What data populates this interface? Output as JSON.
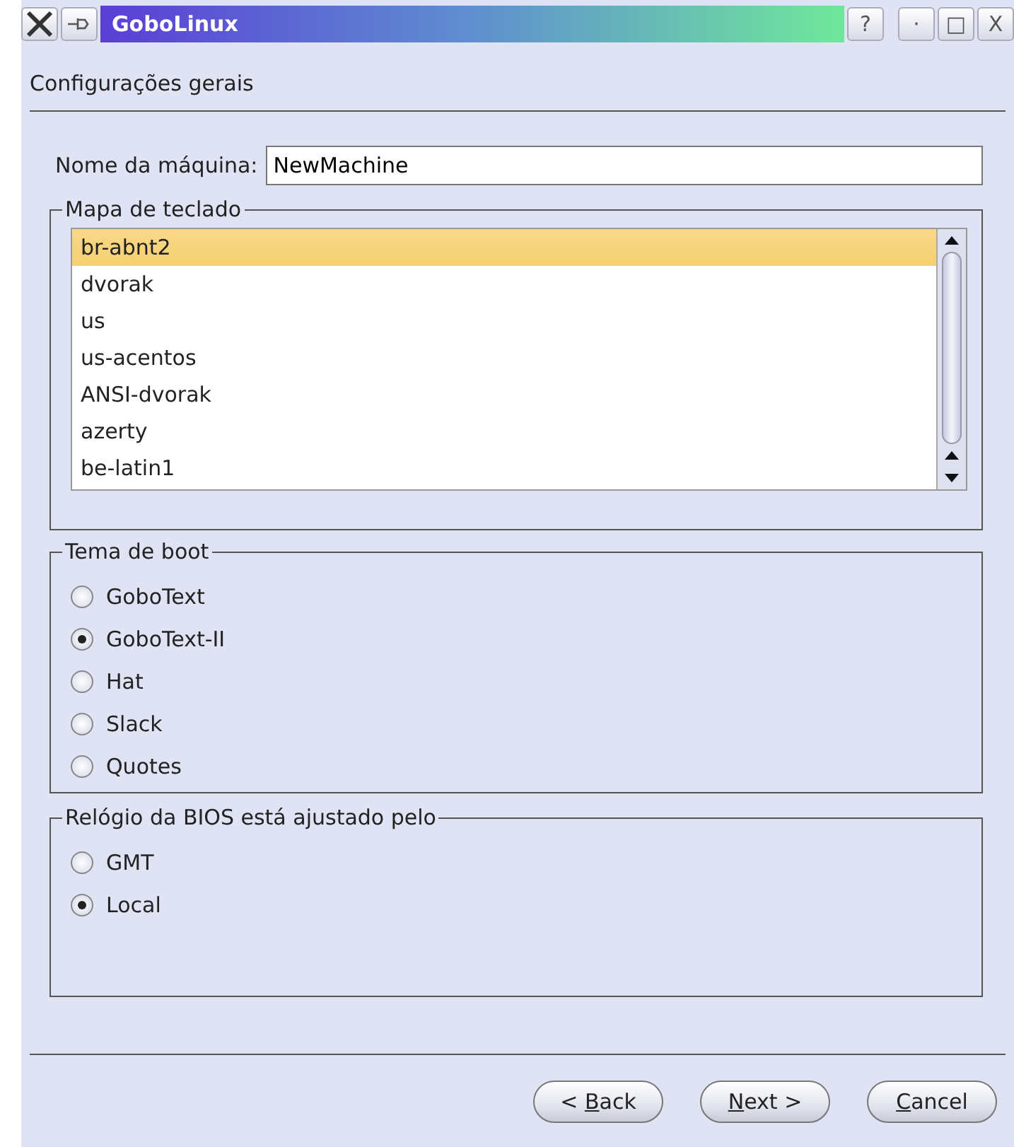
{
  "window": {
    "title": "GoboLinux",
    "title_buttons": [
      "?",
      "·",
      "□",
      "X"
    ]
  },
  "page_title": "Configurações gerais",
  "machine_name": {
    "label": "Nome da máquina:",
    "value": "NewMachine"
  },
  "keymap": {
    "title": "Mapa de teclado",
    "items": [
      {
        "label": "br-abnt2",
        "selected": true
      },
      {
        "label": "dvorak",
        "selected": false
      },
      {
        "label": "us",
        "selected": false
      },
      {
        "label": "us-acentos",
        "selected": false
      },
      {
        "label": "ANSI-dvorak",
        "selected": false
      },
      {
        "label": "azerty",
        "selected": false
      },
      {
        "label": "be-latin1",
        "selected": false
      }
    ]
  },
  "boot_theme": {
    "title": "Tema de boot",
    "options": [
      {
        "label": "GoboText",
        "selected": false
      },
      {
        "label": "GoboText-II",
        "selected": true
      },
      {
        "label": "Hat",
        "selected": false
      },
      {
        "label": "Slack",
        "selected": false
      },
      {
        "label": "Quotes",
        "selected": false
      }
    ]
  },
  "bios_clock": {
    "title": "Relógio da BIOS está ajustado pelo",
    "options": [
      {
        "label": "GMT",
        "selected": false
      },
      {
        "label": "Local",
        "selected": true
      }
    ]
  },
  "buttons": [
    {
      "before": "< ",
      "key": "B",
      "after": "ack",
      "disabled": false
    },
    {
      "key": "N",
      "after": "ext >",
      "disabled": false
    },
    {
      "key": "C",
      "after": "ancel",
      "disabled": false
    }
  ]
}
